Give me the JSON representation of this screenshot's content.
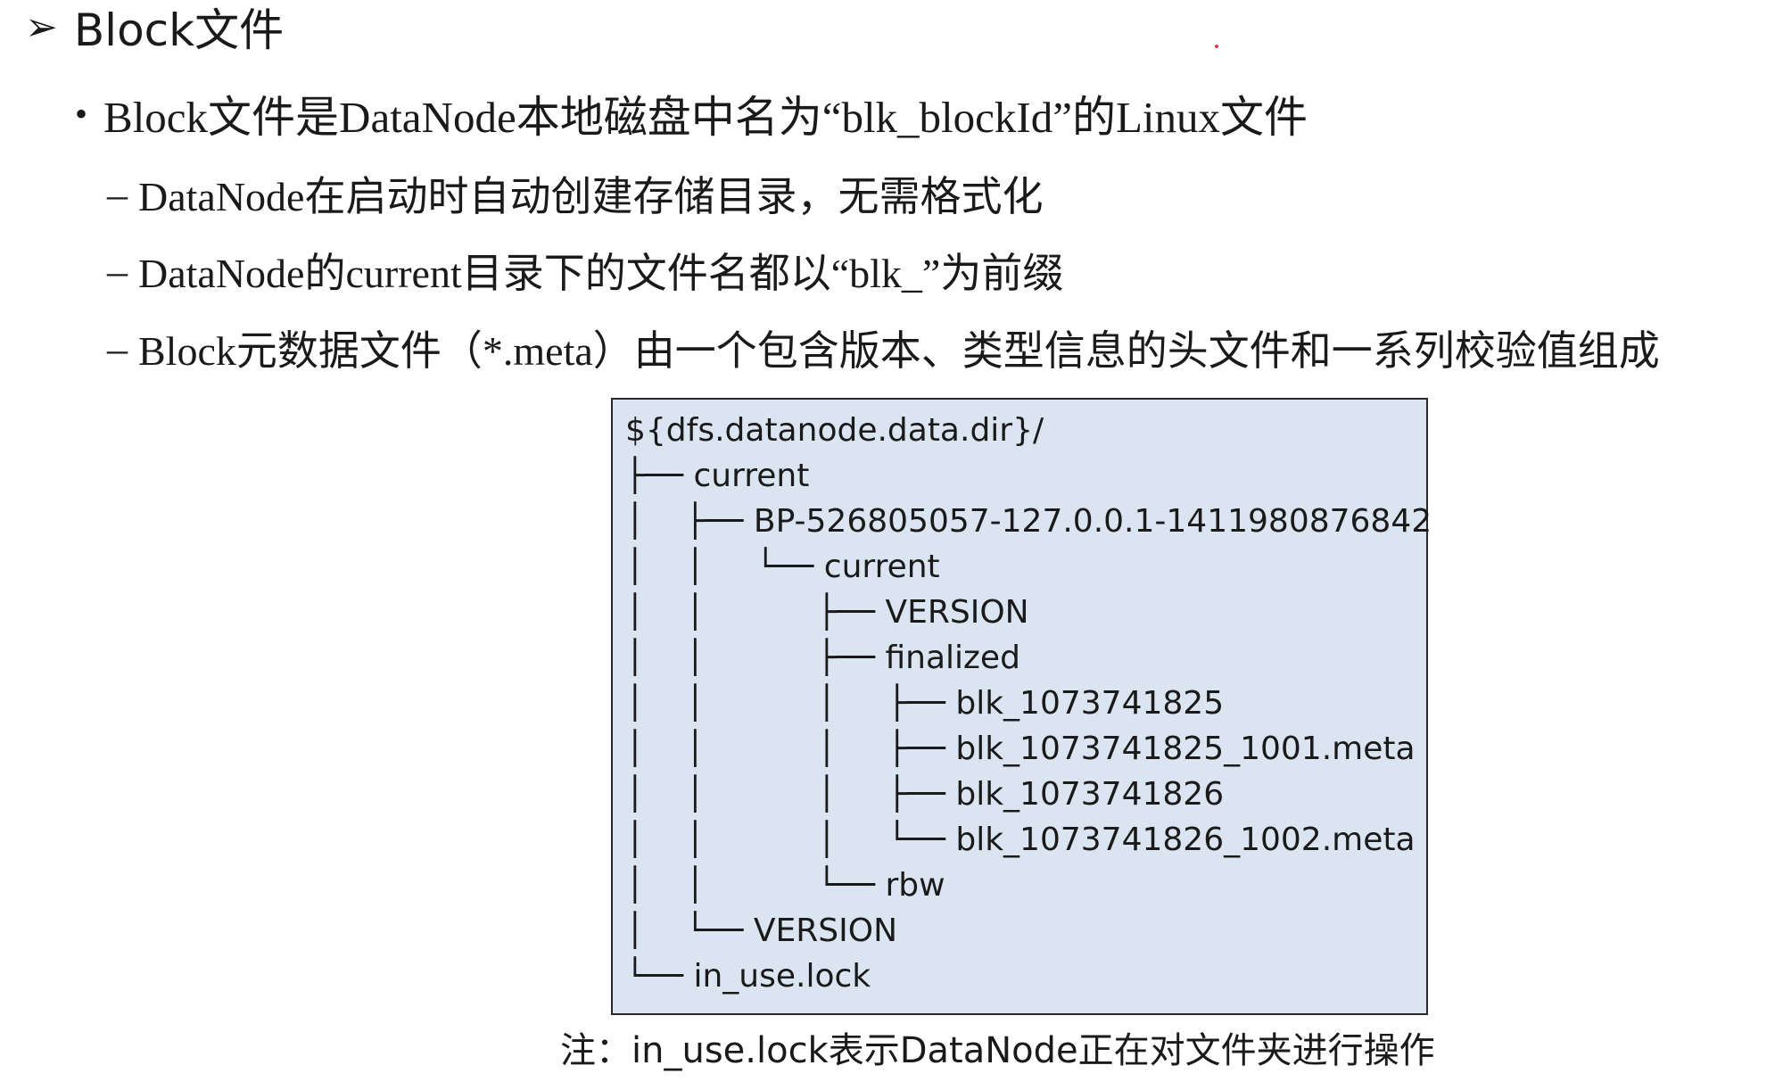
{
  "heading": {
    "arrow": "➢",
    "title": "Block文件"
  },
  "bullet": {
    "marker": "•",
    "text": "Block文件是DataNode本地磁盘中名为“blk_blockId”的Linux文件"
  },
  "sub_items": [
    {
      "marker": "–",
      "text": "DataNode在启动时自动创建存储目录，无需格式化"
    },
    {
      "marker": "–",
      "text": "DataNode的current目录下的文件名都以“blk_”为前缀"
    },
    {
      "marker": "–",
      "text": "Block元数据文件（*.meta）由一个包含版本、类型信息的头文件和一系列校验值组成"
    }
  ],
  "tree_lines": [
    "${dfs.datanode.data.dir}/",
    "├── current",
    "│    ├── BP-526805057-127.0.0.1-1411980876842",
    "│    │     └── current",
    "│    │           ├── VERSION",
    "│    │           ├── finalized",
    "│    │           │     ├── blk_1073741825",
    "│    │           │     ├── blk_1073741825_1001.meta",
    "│    │           │     ├── blk_1073741826",
    "│    │           │     └── blk_1073741826_1002.meta",
    "│    │           └── rbw",
    "│    └── VERSION",
    "└── in_use.lock"
  ],
  "note": "注：in_use.lock表示DataNode正在对文件夹进行操作"
}
